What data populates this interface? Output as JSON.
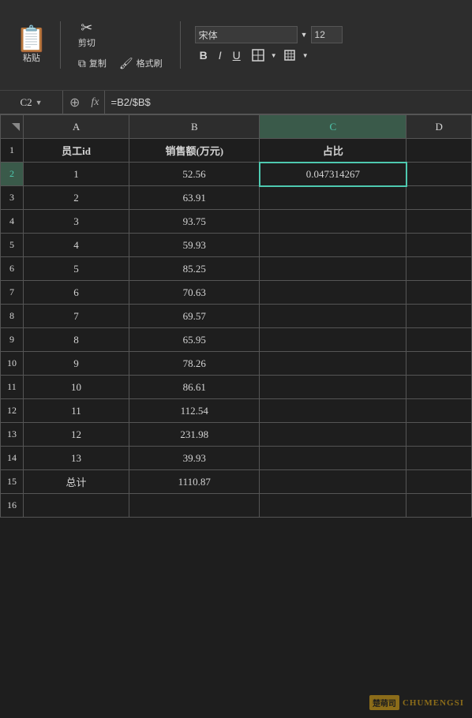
{
  "toolbar": {
    "paste_label": "粘贴",
    "cut_label": "剪切",
    "copy_label": "复制",
    "format_brush_label": "格式刷",
    "font_name": "宋体",
    "font_size": "12",
    "bold_label": "B",
    "italic_label": "I",
    "underline_label": "U",
    "border_label": "⊞",
    "fill_label": "▦"
  },
  "formula_bar": {
    "cell_ref": "C2",
    "formula": "=B2/$B$",
    "search_icon": "🔍",
    "fx_label": "fx"
  },
  "spreadsheet": {
    "columns": [
      "A",
      "B",
      "C",
      "D"
    ],
    "headers": {
      "row_label": "",
      "col_a": "A",
      "col_b": "B",
      "col_c": "C",
      "col_d": "D"
    },
    "rows": [
      {
        "row_num": "1",
        "a": "员工id",
        "b": "销售额(万元)",
        "c": "占比",
        "d": ""
      },
      {
        "row_num": "2",
        "a": "1",
        "b": "52.56",
        "c": "0.047314267",
        "d": "",
        "active_c": true
      },
      {
        "row_num": "3",
        "a": "2",
        "b": "63.91",
        "c": "",
        "d": ""
      },
      {
        "row_num": "4",
        "a": "3",
        "b": "93.75",
        "c": "",
        "d": ""
      },
      {
        "row_num": "5",
        "a": "4",
        "b": "59.93",
        "c": "",
        "d": ""
      },
      {
        "row_num": "6",
        "a": "5",
        "b": "85.25",
        "c": "",
        "d": ""
      },
      {
        "row_num": "7",
        "a": "6",
        "b": "70.63",
        "c": "",
        "d": ""
      },
      {
        "row_num": "8",
        "a": "7",
        "b": "69.57",
        "c": "",
        "d": ""
      },
      {
        "row_num": "9",
        "a": "8",
        "b": "65.95",
        "c": "",
        "d": ""
      },
      {
        "row_num": "10",
        "a": "9",
        "b": "78.26",
        "c": "",
        "d": ""
      },
      {
        "row_num": "11",
        "a": "10",
        "b": "86.61",
        "c": "",
        "d": ""
      },
      {
        "row_num": "12",
        "a": "11",
        "b": "112.54",
        "c": "",
        "d": ""
      },
      {
        "row_num": "13",
        "a": "12",
        "b": "231.98",
        "c": "",
        "d": ""
      },
      {
        "row_num": "14",
        "a": "13",
        "b": "39.93",
        "c": "",
        "d": ""
      },
      {
        "row_num": "15",
        "a": "总计",
        "b": "1110.87",
        "c": "",
        "d": ""
      },
      {
        "row_num": "16",
        "a": "",
        "b": "",
        "c": "",
        "d": ""
      }
    ]
  },
  "watermark": {
    "box_text": "楚萌司",
    "site_text": "CHUMENGSI"
  }
}
